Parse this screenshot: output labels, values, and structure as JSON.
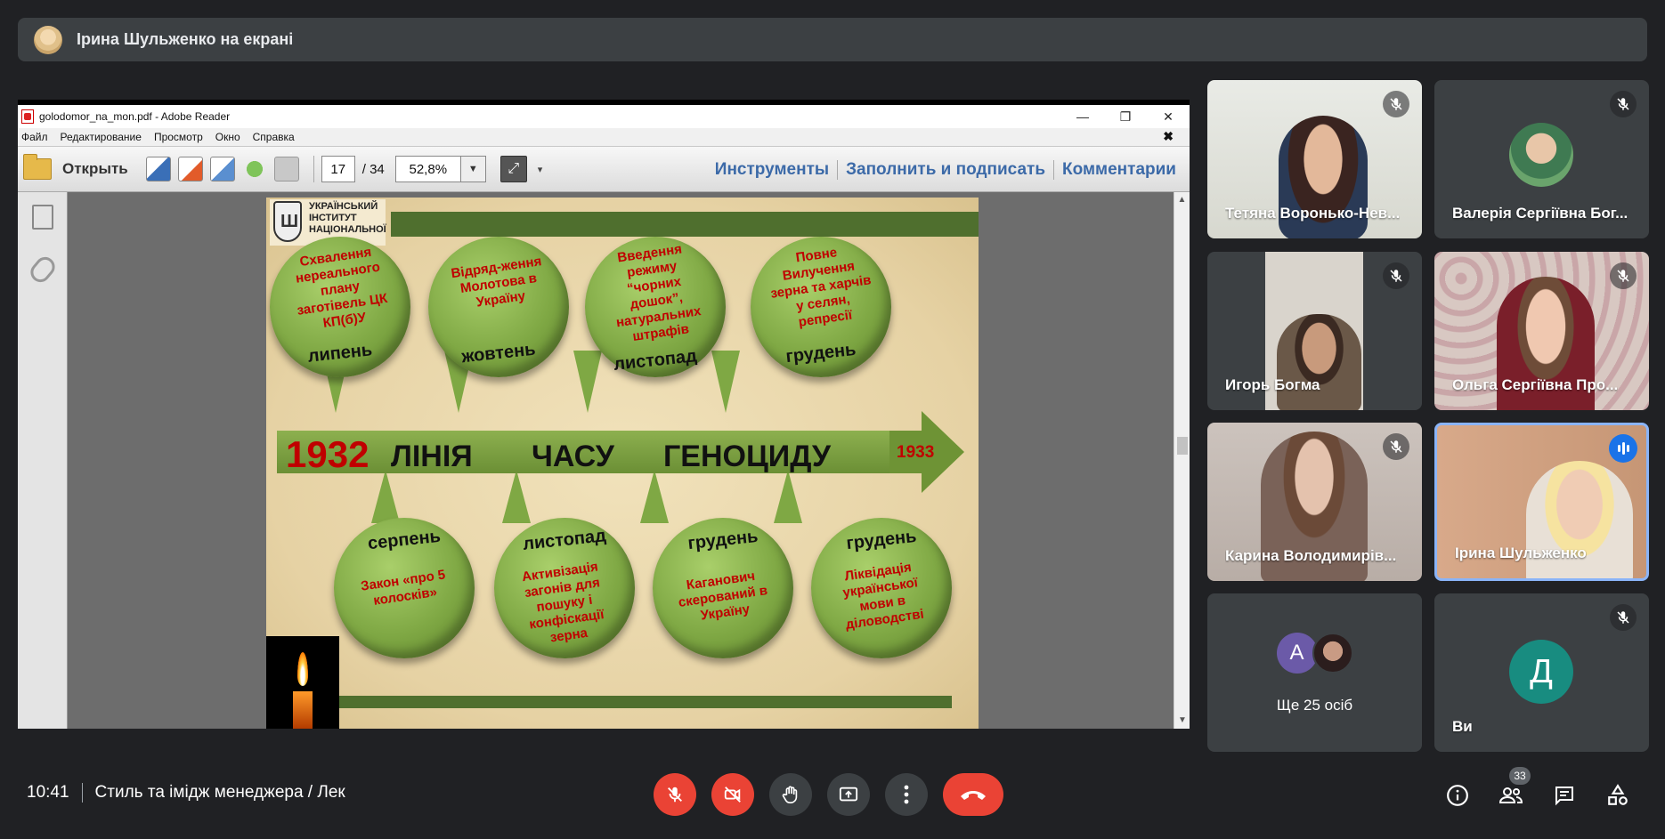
{
  "top_bar": {
    "presenter_label": "Ірина Шульженко на екрані"
  },
  "reader": {
    "window_title": "golodomor_na_mon.pdf - Adobe Reader",
    "menu": [
      "Файл",
      "Редактирование",
      "Просмотр",
      "Окно",
      "Справка"
    ],
    "open_label": "Открыть",
    "page_current": "17",
    "page_total": "/  34",
    "zoom": "52,8%",
    "tool_links": [
      "Инструменты",
      "Заполнить и подписать",
      "Комментарии"
    ]
  },
  "slide": {
    "institute": "УКРАЇНСЬКИЙ ІНСТИТУТ НАЦІОНАЛЬНОЇ",
    "year_start": "1932",
    "year_end": "1933",
    "timeline_words": [
      "ЛІНІЯ",
      "ЧАСУ",
      "ГЕНОЦИДУ"
    ],
    "top_events": [
      {
        "text": "Схвалення нереального плану заготівель ЦК КП(б)У",
        "month": "липень"
      },
      {
        "text": "Відряд-ження Молотова в Україну",
        "month": "жовтень"
      },
      {
        "text": "Введення режиму “чорних дошок”, натуральних штрафів",
        "month": "листопад"
      },
      {
        "text": "Повне Вилучення зерна та харчів у селян, репресії",
        "month": "грудень"
      }
    ],
    "bottom_events": [
      {
        "month": "серпень",
        "text": "Закон «про 5 колосків»"
      },
      {
        "month": "листопад",
        "text": "Активізація загонів для пошуку і конфіскації зерна"
      },
      {
        "month": "грудень",
        "text": "Каганович скерований в Україну"
      },
      {
        "month": "грудень",
        "text": "Ліквідація української мови в діловодстві"
      }
    ]
  },
  "participants": [
    {
      "name": "Тетяна Воронько-Нев..."
    },
    {
      "name": "Валерія Сергіївна Бог..."
    },
    {
      "name": "Игорь Богма"
    },
    {
      "name": "Ольга Сергіївна Про..."
    },
    {
      "name": "Карина Володимирів..."
    },
    {
      "name": "Ірина Шульженко"
    },
    {
      "name": "Ще 25 осіб",
      "avatar_letter": "А"
    },
    {
      "name": "Ви",
      "avatar_letter": "Д"
    }
  ],
  "bottom_bar": {
    "time": "10:41",
    "meeting_title": "Стиль та імідж менеджера / Лек",
    "participant_count": "33"
  },
  "colors": {
    "end_call": "#ea4335",
    "active_speaker": "#1a73e8",
    "you_avatar": "#188c80"
  }
}
